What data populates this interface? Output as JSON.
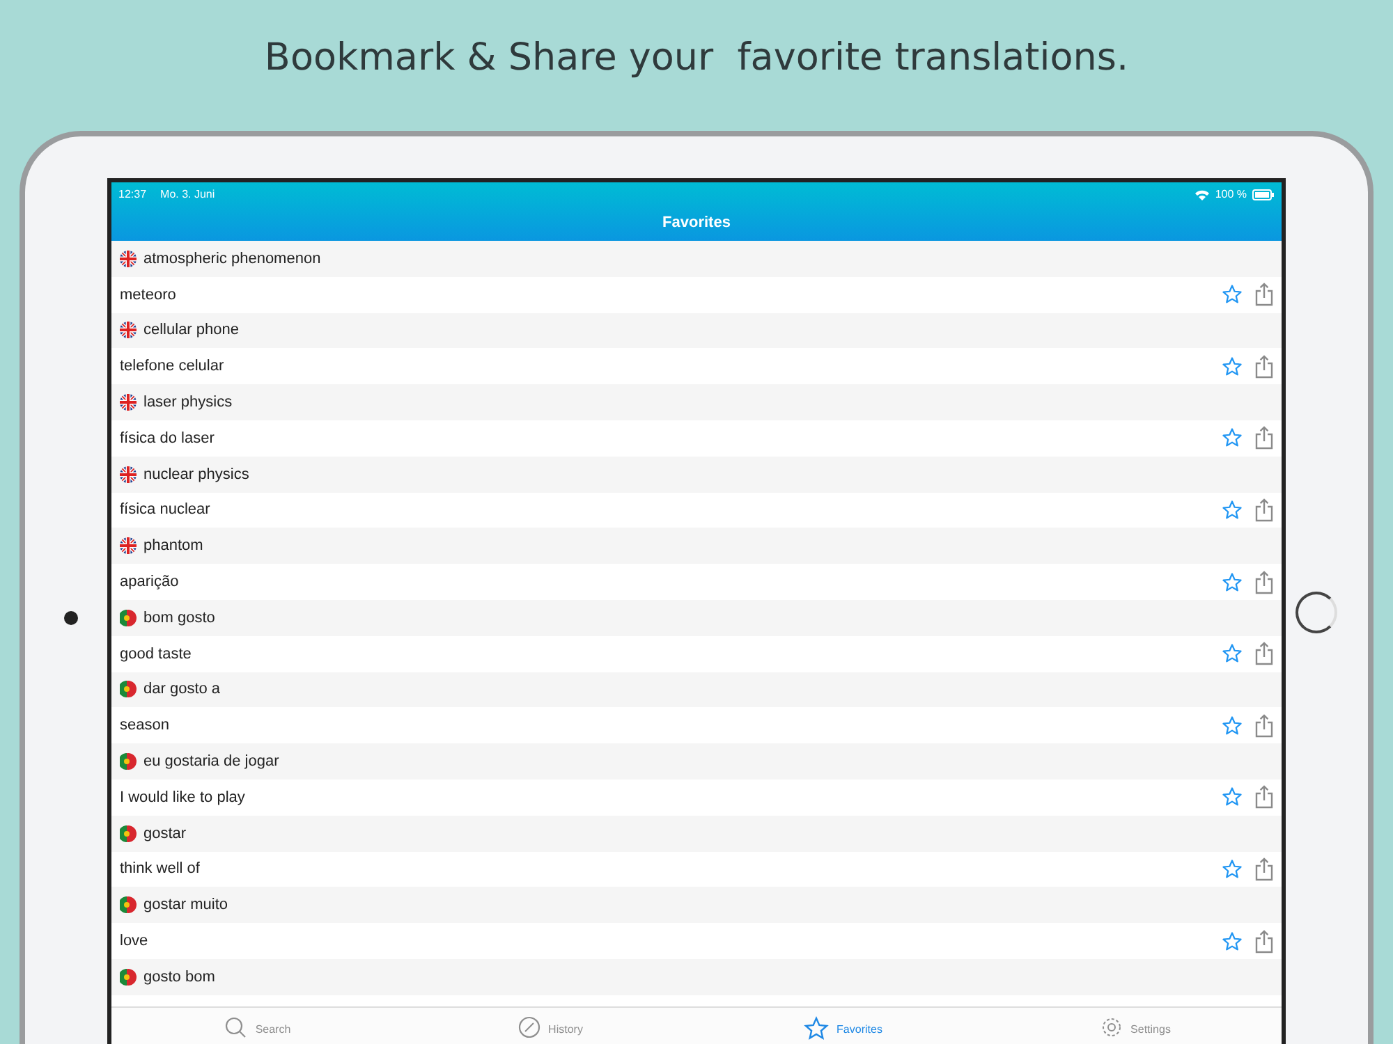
{
  "headline": "Bookmark & Share your  favorite translations.",
  "status_bar": {
    "time": "12:37",
    "date": "Mo. 3. Juni",
    "battery": "100 %"
  },
  "nav": {
    "title": "Favorites"
  },
  "favorites": [
    {
      "kind": "en",
      "term": "atmospheric phenomenon",
      "translation": "meteoro"
    },
    {
      "kind": "en",
      "term": "cellular phone",
      "translation": "telefone celular"
    },
    {
      "kind": "en",
      "term": "laser physics",
      "translation": "física do laser"
    },
    {
      "kind": "en",
      "term": "nuclear physics",
      "translation": "física nuclear"
    },
    {
      "kind": "en",
      "term": "phantom",
      "translation": "aparição"
    },
    {
      "kind": "pt",
      "term": "bom gosto",
      "translation": "good taste"
    },
    {
      "kind": "pt",
      "term": "dar gosto a",
      "translation": "season"
    },
    {
      "kind": "pt",
      "term": "eu gostaria de jogar",
      "translation": "I would like to play"
    },
    {
      "kind": "pt",
      "term": "gostar",
      "translation": "think well of"
    },
    {
      "kind": "pt",
      "term": "gostar muito",
      "translation": "love"
    },
    {
      "kind": "pt",
      "term": "gosto bom"
    }
  ],
  "tabs": [
    {
      "kind": "search",
      "label": "Search",
      "selected": false
    },
    {
      "kind": "history",
      "label": "History",
      "selected": false
    },
    {
      "kind": "favorites",
      "label": "Favorites",
      "selected": true
    },
    {
      "kind": "settings",
      "label": "Settings",
      "selected": false
    }
  ]
}
